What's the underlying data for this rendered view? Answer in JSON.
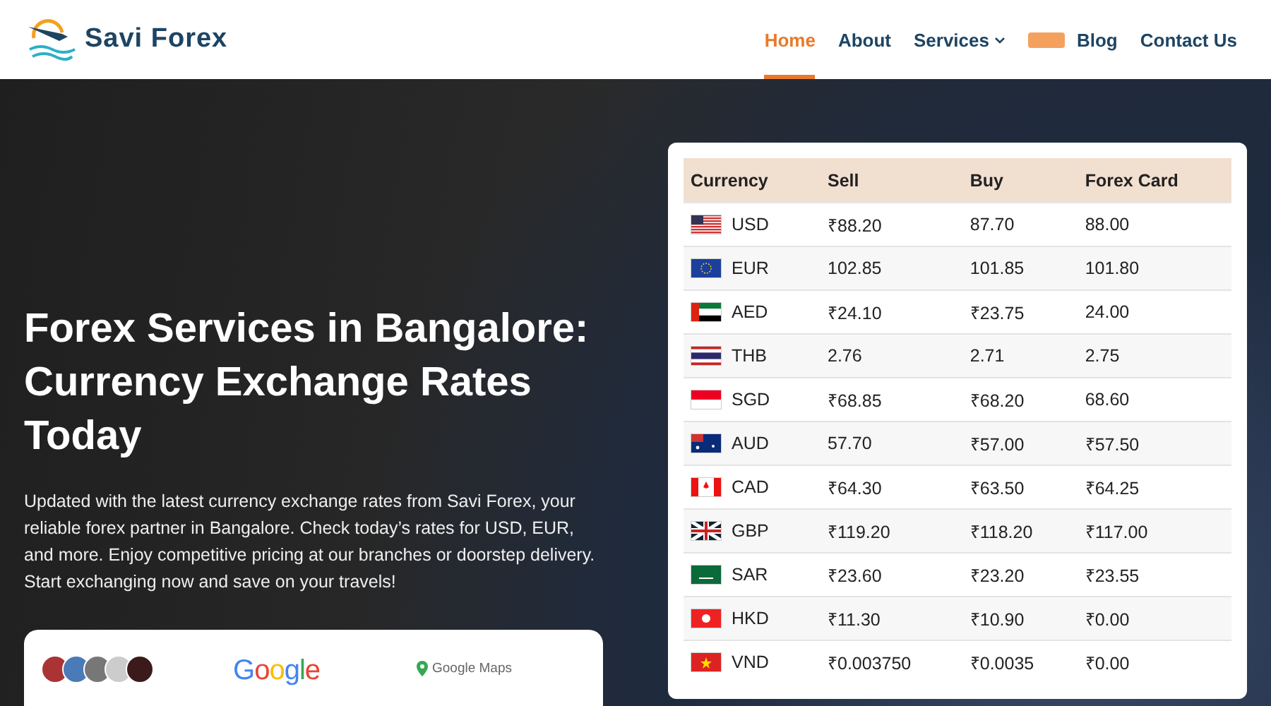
{
  "logo": {
    "text": "Savi Forex"
  },
  "nav": [
    {
      "kind": "link",
      "label": "Home",
      "selected": true
    },
    {
      "kind": "link",
      "label": "About",
      "selected": false
    },
    {
      "kind": "dropdown",
      "label": "Services",
      "selected": false
    },
    {
      "kind": "badge"
    },
    {
      "kind": "link",
      "label": "Blog",
      "selected": false
    },
    {
      "kind": "link",
      "label": "Contact Us",
      "selected": false
    }
  ],
  "hero": {
    "title": "Forex Services in Bangalore: Currency Exchange Rates Today",
    "description": "Updated with the latest currency exchange rates from Savi Forex, your reliable forex partner in Bangalore. Check today’s rates for USD, EUR, and more. Enjoy competitive pricing at our branches or doorstep delivery. Start exchanging now and save on your travels!"
  },
  "stats_card": {
    "google": "Google",
    "maps": "Google Maps"
  },
  "rates_table": {
    "columns": [
      "Currency",
      "Sell",
      "Buy",
      "Forex Card"
    ],
    "rows": [
      {
        "currency": "USD",
        "sell": "₹88.20",
        "buy": "87.70",
        "card": "88.00"
      },
      {
        "currency": "EUR",
        "sell": "102.85",
        "buy": "101.85",
        "card": "101.80"
      },
      {
        "currency": "AED",
        "sell": "₹24.10",
        "buy": "₹23.75",
        "card": "24.00"
      },
      {
        "currency": "THB",
        "sell": "2.76",
        "buy": "2.71",
        "card": "2.75"
      },
      {
        "currency": "SGD",
        "sell": "₹68.85",
        "buy": "₹68.20",
        "card": "68.60"
      },
      {
        "currency": "AUD",
        "sell": "57.70",
        "buy": "₹57.00",
        "card": "₹57.50"
      },
      {
        "currency": "CAD",
        "sell": "₹64.30",
        "buy": "₹63.50",
        "card": "₹64.25"
      },
      {
        "currency": "GBP",
        "sell": "₹119.20",
        "buy": "₹118.20",
        "card": "₹117.00"
      },
      {
        "currency": "SAR",
        "sell": "₹23.60",
        "buy": "₹23.20",
        "card": "₹23.55"
      },
      {
        "currency": "HKD",
        "sell": "₹11.30",
        "buy": "₹10.90",
        "card": "₹0.00"
      },
      {
        "currency": "VND",
        "sell": "₹0.003750",
        "buy": "₹0.0035",
        "card": "₹0.00"
      }
    ]
  }
}
